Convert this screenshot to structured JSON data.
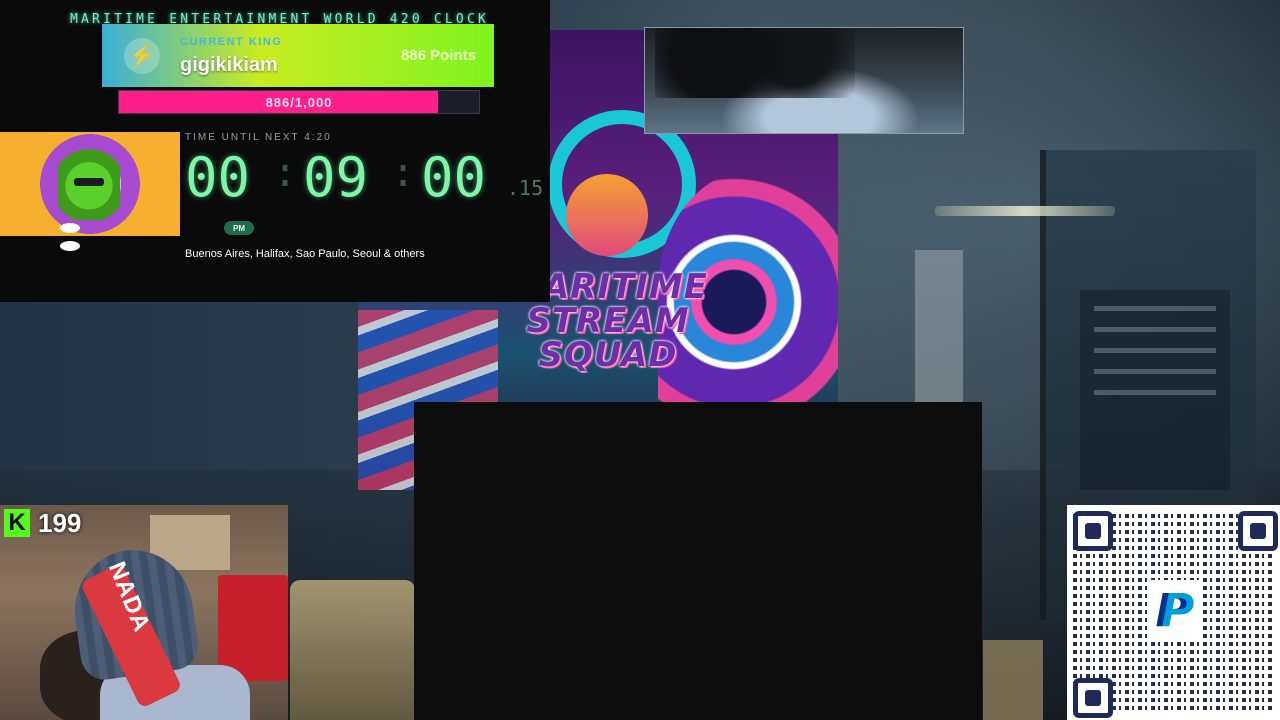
{
  "clock": {
    "title": "MARITIME ENTERTAINMENT WORLD 420 CLOCK",
    "current_king_label": "CURRENT KING",
    "king_name": "gigikikiam",
    "king_points": "886 Points",
    "progress_text": "886/1,000",
    "progress_value": 886,
    "progress_max": 1000,
    "timer_label": "TIME UNTIL NEXT 4:20",
    "hours": "00",
    "minutes": "09",
    "seconds": "00",
    "fraction": ".15",
    "ampm": "PM",
    "cities": "Buenos Aires, Halifax, Sao Paulo, Seoul & others"
  },
  "poster": {
    "text": "MARITIME STREAM SQUAD"
  },
  "webcam": {
    "hat_text": "NADA",
    "sub_count": "199"
  },
  "icons": {
    "king": "lightning-icon",
    "platform": "kick-icon",
    "donate": "paypal-icon"
  },
  "colors": {
    "accent_green": "#7ff5a8",
    "progress_pink": "#ff1f8a",
    "kick_green": "#53fc18",
    "paypal_blue": "#003087"
  }
}
